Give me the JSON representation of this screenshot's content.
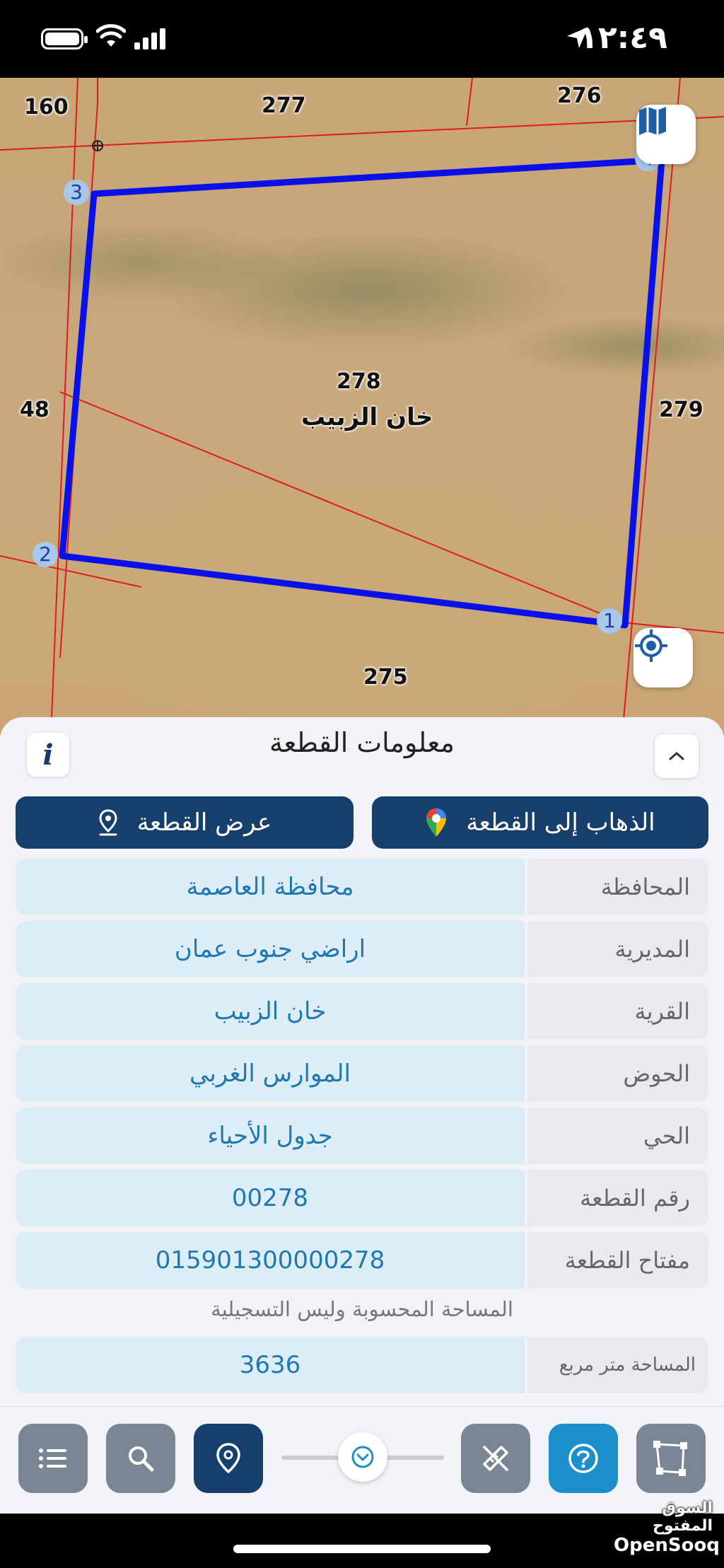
{
  "status_bar": {
    "time": "١٢:٤٩"
  },
  "map": {
    "parcel_labels": {
      "p160": "160",
      "p277": "277",
      "p276": "276",
      "p48": "48",
      "p279": "279",
      "p275": "275",
      "p278_number": "278",
      "p278_name": "خان الزبيب"
    },
    "vertices": [
      "1",
      "2",
      "3",
      "4"
    ],
    "polygon_color": "#0a10e8",
    "boundary_color": "#e01d1d"
  },
  "info_panel": {
    "title": "معلومات القطعة",
    "goto_button": "الذهاب إلى القطعة",
    "show_button": "عرض القطعة",
    "rows": [
      {
        "label": "المحافظة",
        "value": "محافظة العاصمة"
      },
      {
        "label": "المديرية",
        "value": "اراضي جنوب عمان"
      },
      {
        "label": "القرية",
        "value": "خان الزبيب"
      },
      {
        "label": "الحوض",
        "value": "الموارس الغربي"
      },
      {
        "label": "الحي",
        "value": "جدول الأحياء"
      },
      {
        "label": "رقم القطعة",
        "value": "00278"
      },
      {
        "label": "مفتاح القطعة",
        "value": "015901300000278"
      }
    ],
    "area_note": "المساحة المحسوبة وليس التسجيلية",
    "area_row": {
      "label": "المساحة متر مربع",
      "value": "3636"
    }
  },
  "toolbar": {
    "items": [
      "list-icon",
      "search-icon",
      "location-pin-icon",
      "chevron-down-icon",
      "measure-icon",
      "help-icon",
      "polygon-icon"
    ]
  },
  "watermark": {
    "arabic": "السوق المفتوح",
    "latin": "OpenSooq"
  },
  "colors": {
    "accent": "#173f6b",
    "value_text": "#1f79b0",
    "help": "#1b8fc9"
  }
}
